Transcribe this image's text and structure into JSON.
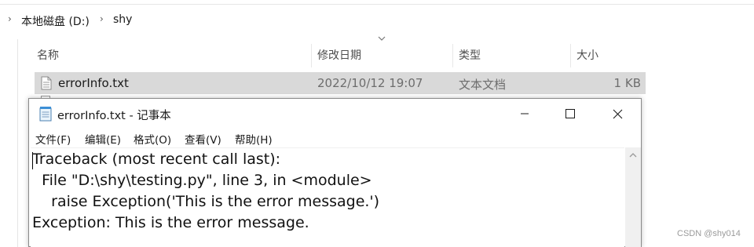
{
  "explorer": {
    "breadcrumb": [
      "本地磁盘 (D:)",
      "shy"
    ],
    "columns": {
      "name": "名称",
      "date": "修改日期",
      "type": "类型",
      "size": "大小"
    },
    "file": {
      "name": "errorInfo.txt",
      "date": "2022/10/12 19:07",
      "type": "文本文档",
      "size": "1 KB"
    }
  },
  "notepad": {
    "title": "errorInfo.txt - 记事本",
    "menu": [
      "文件(F)",
      "编辑(E)",
      "格式(O)",
      "查看(V)",
      "帮助(H)"
    ],
    "content": [
      "Traceback (most recent call last):",
      "  File \"D:\\shy\\testing.py\", line 3, in <module>",
      "    raise Exception('This is the error message.')",
      "Exception: This is the error message."
    ]
  },
  "watermark": "CSDN @shy014",
  "icons": {
    "chevron": "chevron-right-icon",
    "sort": "sort-down-icon",
    "file": "text-file-icon",
    "notepad": "notepad-icon",
    "minimize": "minimize-icon",
    "maximize": "maximize-icon",
    "close": "close-icon",
    "scroll_up": "scroll-up-arrow-icon"
  }
}
